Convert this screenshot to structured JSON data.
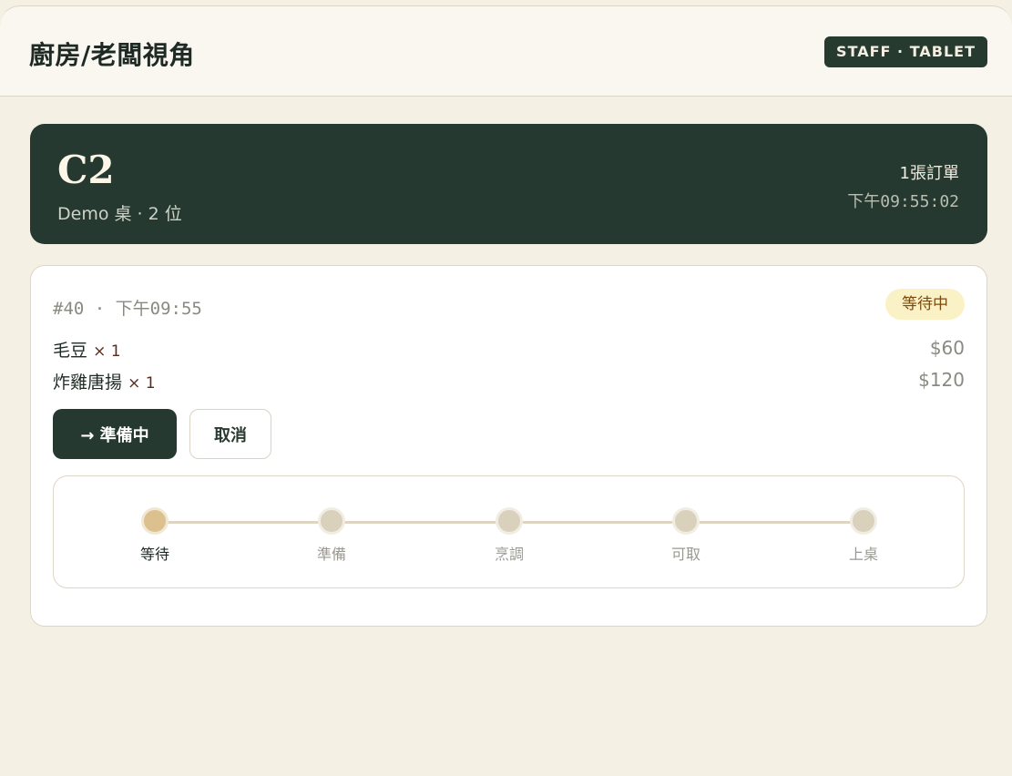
{
  "header": {
    "title": "廚房/老闆視角",
    "badge": "STAFF · TABLET"
  },
  "table": {
    "code": "C2",
    "subtitle": "Demo 桌 · 2 位",
    "order_count": "1張訂單",
    "time": "下午09:55:02"
  },
  "order": {
    "meta": "#40 · 下午09:55",
    "status": "等待中",
    "items": [
      {
        "name": "毛豆",
        "qty": "× 1",
        "price": "$60"
      },
      {
        "name": "炸雞唐揚",
        "qty": "× 1",
        "price": "$120"
      }
    ],
    "primary_action": "→ 準備中",
    "cancel_action": "取消",
    "progress": {
      "current_step": 0,
      "steps": [
        "等待",
        "準備",
        "烹調",
        "可取",
        "上桌"
      ]
    }
  },
  "colors": {
    "background": "#f4f0e4",
    "dark_green": "#253930",
    "status_pill_bg": "#fbf1c6",
    "active_step": "#dcc08e"
  }
}
